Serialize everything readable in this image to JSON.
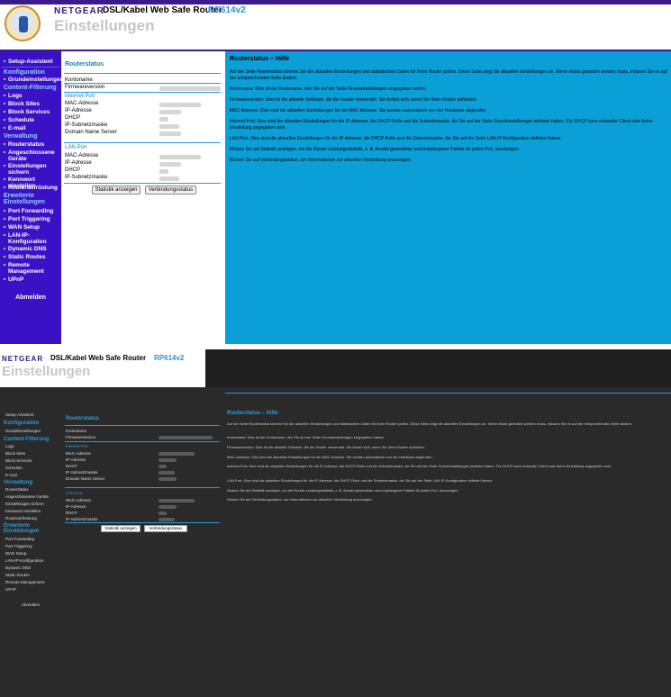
{
  "header": {
    "brand": "NETGEAR",
    "product": "DSL/Kabel Web Safe Router",
    "model": "RP614v2",
    "title": "Einstellungen"
  },
  "sidebar": {
    "setup": "Setup-Assistent",
    "cat_config": "Konfiguration",
    "basic": "Grundeinstellungen",
    "cat_content": "Content-Filterung",
    "logs": "Logs",
    "block_sites": "Block Sites",
    "block_services": "Block Services",
    "schedule": "Schedule",
    "email": "E-mail",
    "cat_admin": "Verwaltung",
    "router_status": "Routerstatus",
    "attached": "Angeschlossene Geräte",
    "backup": "Einstellungen sichern",
    "password": "Kennwort einstellen",
    "upgrade": "Routeraufrüstung",
    "cat_advanced": "Erweiterte Einstellungen",
    "port_forwarding": "Port Forwarding",
    "port_triggering": "Port Triggering",
    "wan": "WAN Setup",
    "lan": "LAN-IP-Konfiguration",
    "ddns": "Dynamic DNS",
    "routes": "Static Routes",
    "remote": "Remote Management",
    "upnp": "UPnP",
    "logout": "Abmelden"
  },
  "status": {
    "title": "Routerstatus",
    "account": "Kontoname",
    "firmware": "Firmwareversion",
    "internet_port": "Internet-Port",
    "mac": "MAC-Adresse",
    "ip": "IP-Adresse",
    "dhcp": "DHCP",
    "subnet": "IP-Subnetzmaske",
    "dns": "Domain Name Server",
    "lan_port": "LAN-Port",
    "btn_stats": "Statistik anzeigen",
    "btn_conn": "Verbindungsstatus"
  },
  "help": {
    "title": "Routerstatus – Hilfe",
    "p1": "Auf der Seite Routerstatus können Sie die aktuellen Einstellungen und statistischen Daten für Ihren Router prüfen. Diese Seite zeigt die aktuellen Einstellungen an. Wenn etwas geändert werden muss, müssen Sie es auf der entsprechenden Seite ändern.",
    "p2": "Kontoname: Dies ist der Kontoname, den Sie auf der Seite Grundeinstellungen eingegeben haben.",
    "p3": "Firmwareversion: Dies ist die aktuelle Software, die der Router verwendet. Sie ändert sich, wenn Sie Ihren Router aufrüsten.",
    "p4": "MAC-Adresse: Dies sind die aktuellen Einstellungen für die MAC-Adresse. Sie werden automatisch von der Hardware abgerufen.",
    "p5": "Internet-Port: Dies sind die aktuellen Einstellungen für die IP-Adresse, die DHCP-Rolle und die Subnetzmaske, die Sie auf der Seite Grundeinstellungen definiert haben. Für DHCP kann entweder Client oder keine Einstellung angegeben sein.",
    "p6": "LAN-Port: Dies sind die aktuellen Einstellungen für die IP-Adresse, die DHCP-Rolle und die Subnetzmaske, die Sie auf der Seite LAN-IP-Konfiguration definiert haben.",
    "p7": "Klicken Sie auf Statistik anzeigen, um die Router-Leistungsstatistik, z. B. Anzahl gesendeter und empfangener Pakete für jeden Port, anzuzeigen.",
    "p8": "Klicken Sie auf Verbindungsstatus, um Informationen zur aktuellen Verbindung anzuzeigen."
  }
}
